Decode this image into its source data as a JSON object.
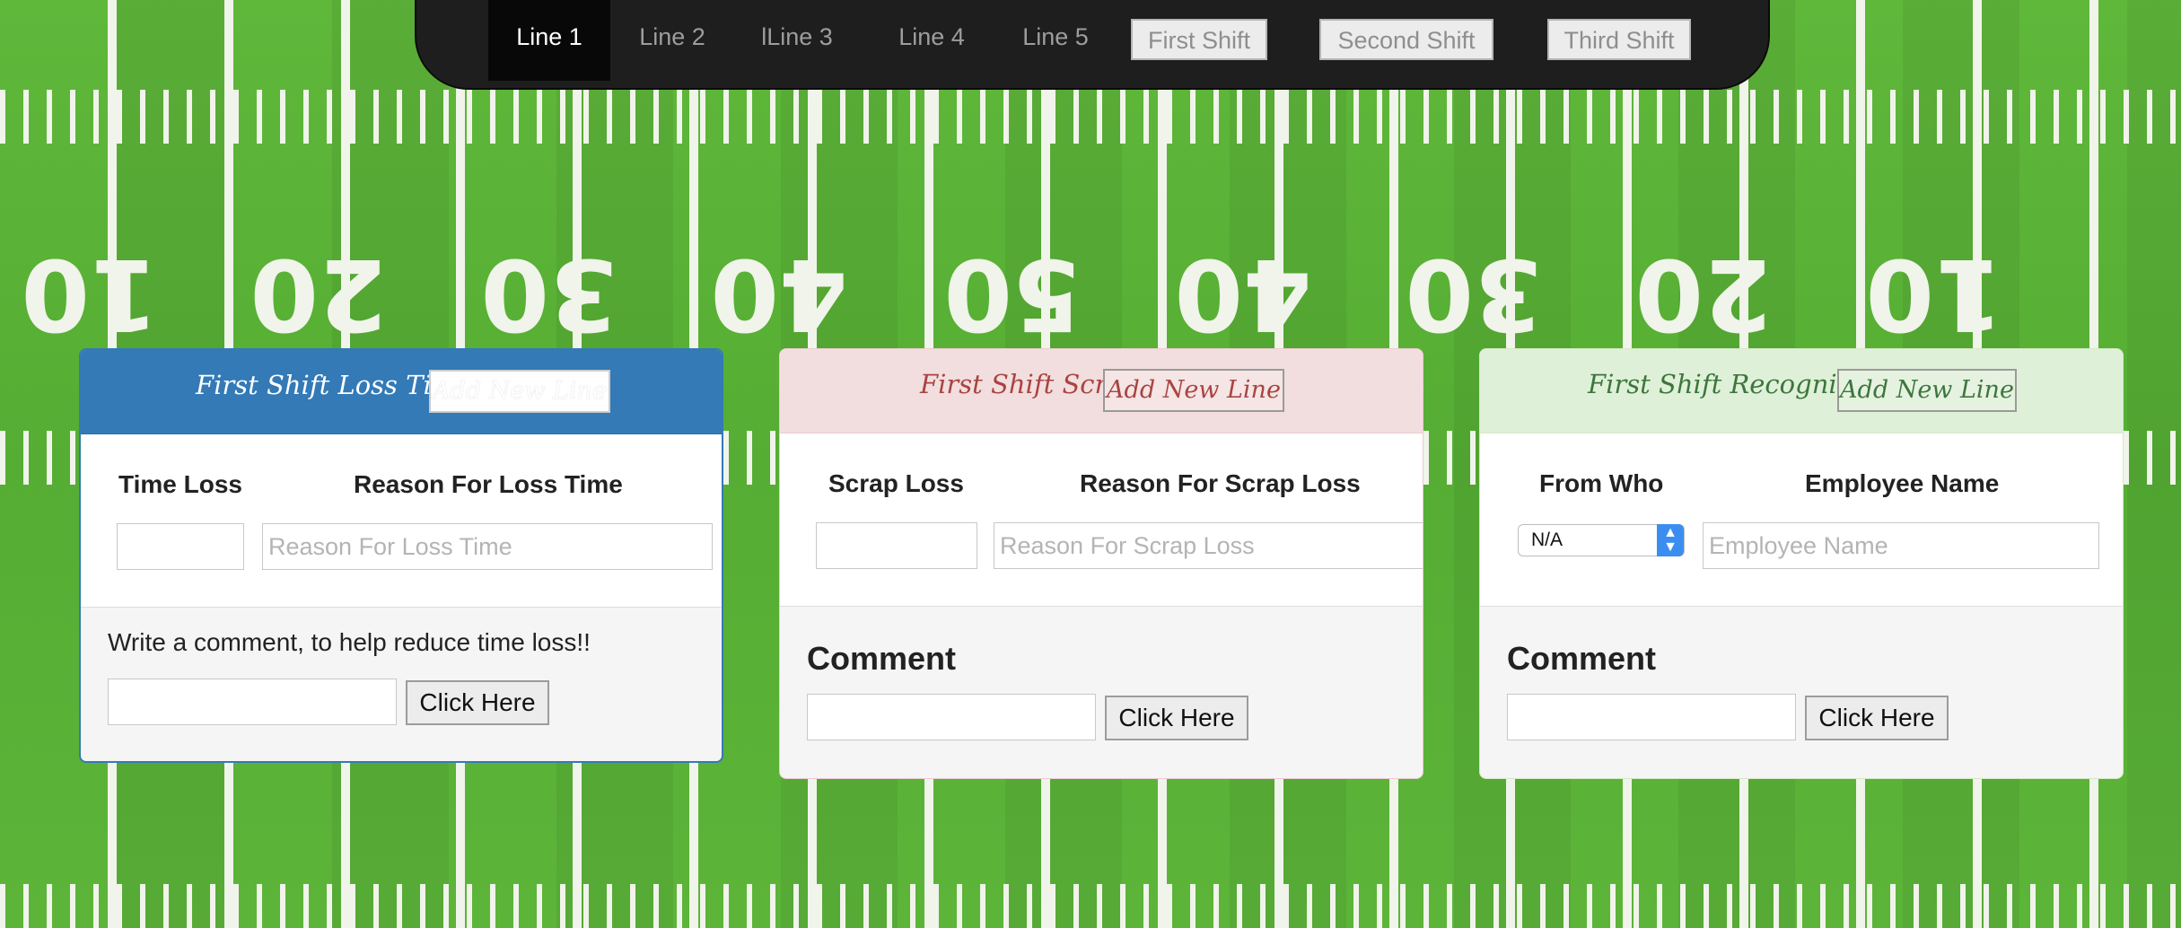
{
  "nav": {
    "lines": [
      "Line 1",
      "Line 2",
      "lLine 3",
      "Line 4",
      "Line 5"
    ],
    "active_line": "Line 1",
    "shifts": [
      "First Shift",
      "Second Shift",
      "Third Shift"
    ]
  },
  "field": {
    "yard_numbers": [
      "10",
      "20",
      "30",
      "40",
      "50",
      "40",
      "30",
      "20",
      "10"
    ],
    "colors": {
      "turf": "#5cb539",
      "lines": "#f0f4ea"
    }
  },
  "panels": {
    "loss": {
      "title": "First Shift Loss Time",
      "add_label": "Add New Line",
      "col1": "Time Loss",
      "col2": "Reason For Loss Time",
      "reason_placeholder": "Reason For Loss Time",
      "footer_text": "Write a comment, to help reduce time loss!!",
      "button": "Click Here",
      "colors": {
        "header": "#337ab7",
        "title": "#ffffff",
        "border": "#337ab7"
      }
    },
    "scrap": {
      "title": "First Shift Scrap",
      "add_label": "Add New Line",
      "col1": "Scrap Loss",
      "col2": "Reason For Scrap Loss",
      "reason_placeholder": "Reason For Scrap Loss",
      "comment_label": "Comment",
      "button": "Click Here",
      "colors": {
        "header": "#f2dede",
        "title": "#a94442"
      }
    },
    "recognition": {
      "title": "First Shift Recognition",
      "add_label": "Add New Line",
      "col1": "From Who",
      "col2": "Employee Name",
      "select_value": "N/A",
      "name_placeholder": "Employee Name",
      "comment_label": "Comment",
      "button": "Click Here",
      "colors": {
        "header": "#dff0d8",
        "title": "#3c763d"
      }
    }
  }
}
